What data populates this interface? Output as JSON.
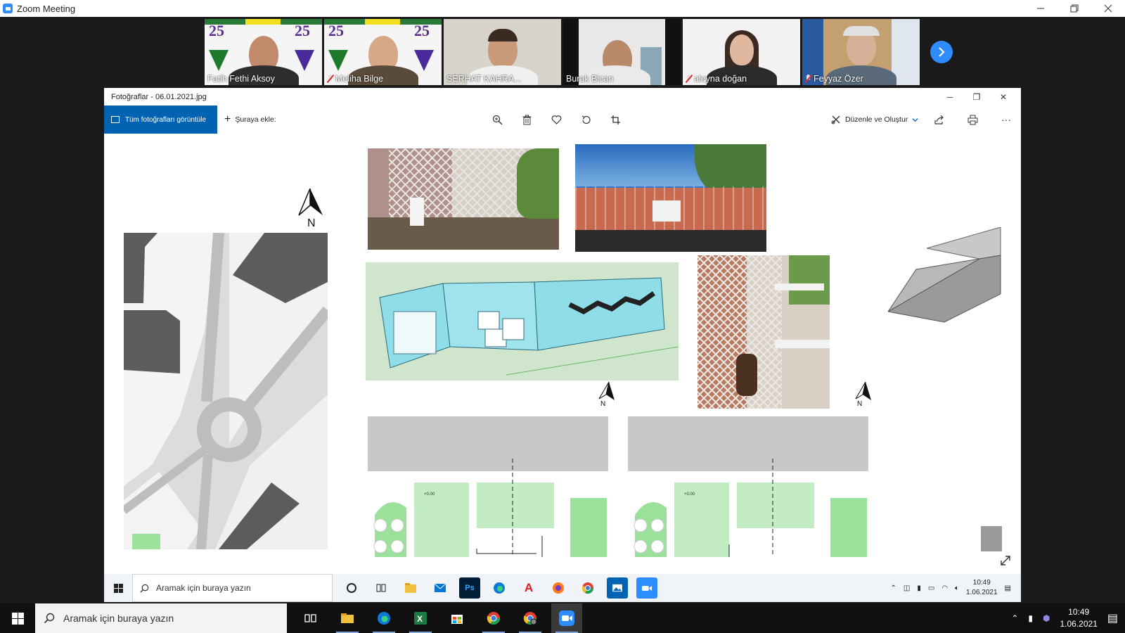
{
  "zoom": {
    "title": "Zoom Meeting",
    "participants": [
      {
        "name": "Fatih Fethi Aksoy",
        "muted": false
      },
      {
        "name": "Meliha Bilge",
        "muted": true
      },
      {
        "name": "SERHAT KAHRA...",
        "muted": false
      },
      {
        "name": "Burak Bican",
        "muted": false
      },
      {
        "name": "aleyna doğan",
        "muted": true
      },
      {
        "name": "Feyyaz Özer",
        "muted": true
      }
    ],
    "poster_number": "25"
  },
  "photos": {
    "title": "Fotoğraflar - 06.01.2021.jpg",
    "view_all_label": "Tüm fotoğrafları görüntüle",
    "add_to_label": "Şuraya ekle:",
    "edit_create_label": "Düzenle ve Oluştur",
    "north_label": "N",
    "elevation_label": "+0.00",
    "more_label": "···"
  },
  "inner_taskbar": {
    "search_placeholder": "Aramak için buraya yazın",
    "time": "10:49",
    "date": "1.06.2021"
  },
  "outer_taskbar": {
    "search_placeholder": "Aramak için buraya yazın",
    "time": "10:49",
    "date": "1.06.2021"
  },
  "colors": {
    "zoom_blue": "#2d8cff",
    "photos_blue": "#0063b1",
    "active_speaker": "#c6d600",
    "plan_green": "#c3ecc3",
    "model_cyan": "#8fdde8"
  }
}
